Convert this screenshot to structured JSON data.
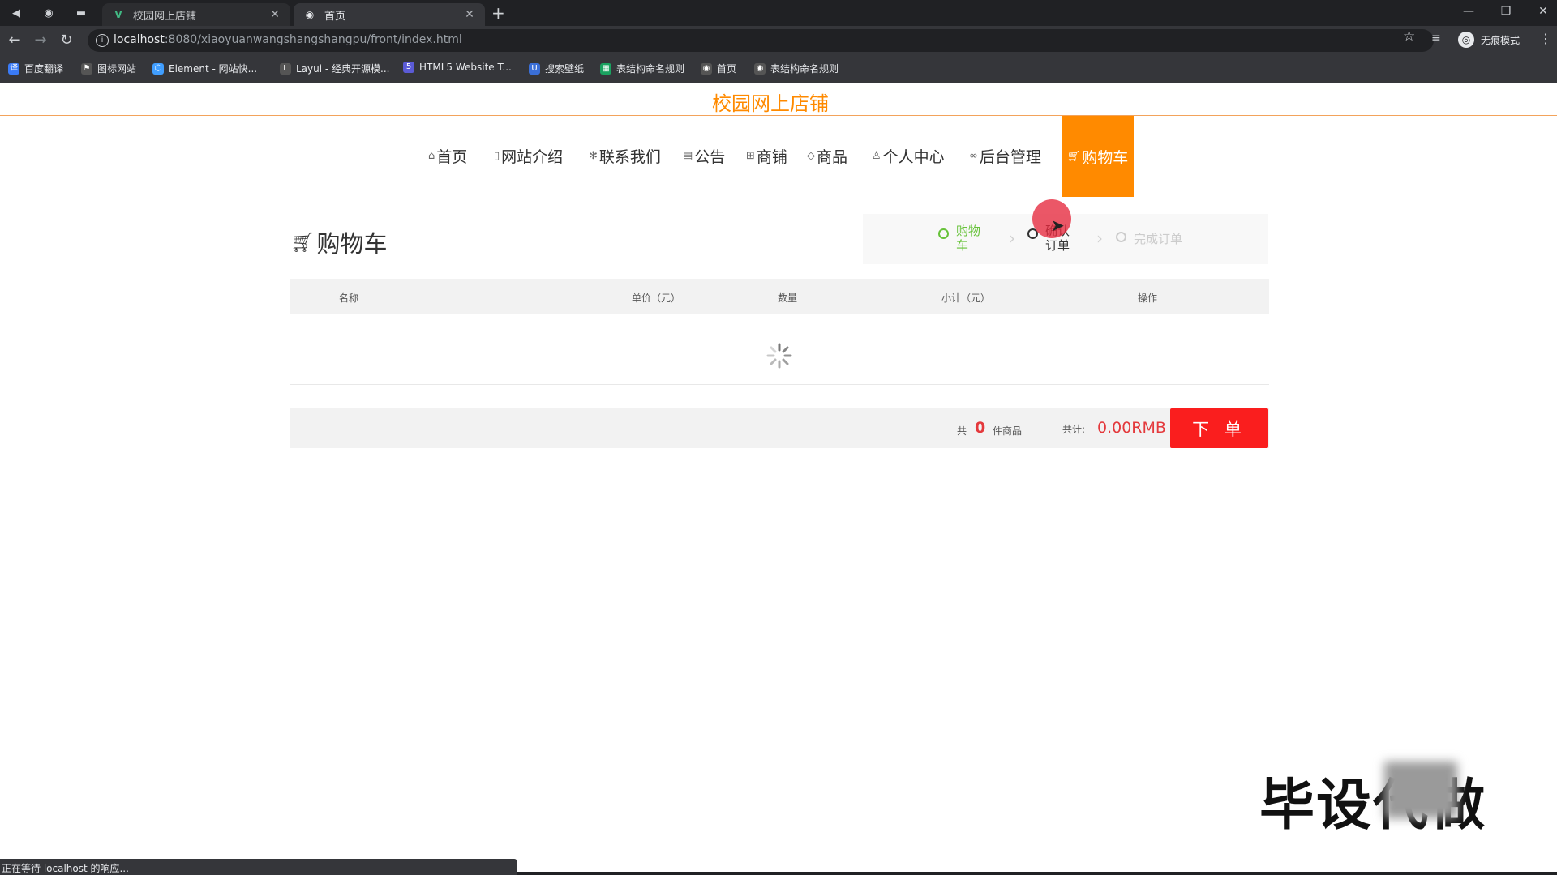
{
  "browser": {
    "tabs": [
      {
        "title": "校园网上店铺"
      },
      {
        "title": "首页"
      }
    ],
    "new_tab_label": "+",
    "url_host": "localhost",
    "url_rest": ":8080/xiaoyuanwangshangshangpu/front/index.html",
    "profile_label": "无痕模式",
    "window_controls": [
      "—",
      "❐",
      "✕"
    ],
    "bookmarks": [
      {
        "label": "百度翻译",
        "icon": "translate-icon",
        "color": "#3a7bf6"
      },
      {
        "label": "图标网站",
        "icon": "flag-icon",
        "color": "#555555"
      },
      {
        "label": "Element - 网站快...",
        "icon": "element-icon",
        "color": "#409eff"
      },
      {
        "label": "Layui - 经典开源模...",
        "icon": "layui-icon",
        "color": "#555555"
      },
      {
        "label": "HTML5 Website T...",
        "icon": "html5-icon",
        "color": "#5b5bd6"
      },
      {
        "label": "搜索壁纸",
        "icon": "wallpaper-icon",
        "color": "#3a6fd8"
      },
      {
        "label": "表结构命名规则",
        "icon": "sheet-icon",
        "color": "#1aa260"
      },
      {
        "label": "首页",
        "icon": "globe-icon",
        "color": "#555555"
      },
      {
        "label": "表结构命名规则",
        "icon": "globe-icon",
        "color": "#555555"
      }
    ]
  },
  "site": {
    "title": "校园网上店铺",
    "accent_color": "#ff8a00"
  },
  "nav": {
    "items": [
      {
        "label": "首页",
        "icon": "home-icon"
      },
      {
        "label": "网站介绍",
        "icon": "document-icon"
      },
      {
        "label": "联系我们",
        "icon": "asterisk-icon"
      },
      {
        "label": "公告",
        "icon": "notice-icon"
      },
      {
        "label": "商铺",
        "icon": "grid-icon"
      },
      {
        "label": "商品",
        "icon": "tag-icon"
      },
      {
        "label": "个人中心",
        "icon": "user-icon"
      },
      {
        "label": "后台管理",
        "icon": "link-icon"
      }
    ],
    "cart": {
      "label": "购物车",
      "icon": "cart-icon",
      "active": true
    }
  },
  "cart_page": {
    "title": "购物车",
    "steps": [
      {
        "label_1": "购物",
        "label_2": "车",
        "state": "done",
        "color": "#67c23a"
      },
      {
        "label_1": "确认",
        "label_2": "订单",
        "state": "current",
        "color": "#333333"
      },
      {
        "label_1": "完成订单",
        "label_2": "",
        "state": "pending",
        "color": "#cccccc"
      }
    ],
    "table": {
      "headers": [
        "名称",
        "单价（元）",
        "数量",
        "小计（元）",
        "操作"
      ],
      "rows": [],
      "loading": true
    },
    "summary": {
      "count_prefix": "共",
      "count": "0",
      "count_suffix": "件商品",
      "total_label": "共计:",
      "total": "0.00RMB",
      "order_button": "下 单",
      "price_color": "#e4393c",
      "button_color": "#fa1e1e"
    }
  },
  "watermark": {
    "text": "毕设代做"
  },
  "status": {
    "text": "正在等待 localhost 的响应..."
  }
}
